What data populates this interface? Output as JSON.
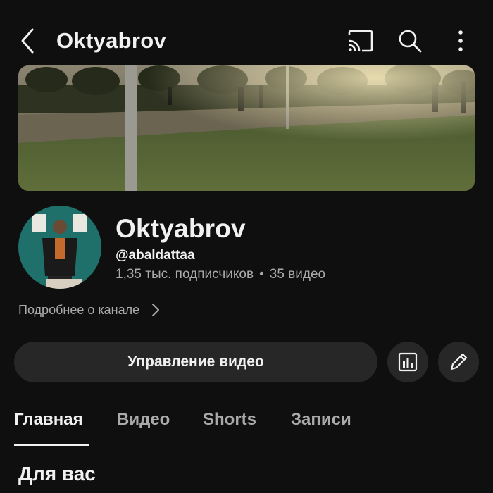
{
  "header": {
    "title": "Oktyabrov",
    "icons": [
      "back-icon",
      "cast-icon",
      "search-icon",
      "more-vert-icon"
    ]
  },
  "channel": {
    "name": "Oktyabrov",
    "handle": "@abaldattaa",
    "subscribers": "1,35 тыс. подписчиков",
    "separator": "•",
    "videos": "35 видео",
    "more_about": "Подробнее о канале"
  },
  "actions": {
    "manage_label": "Управление видео",
    "icons": [
      "analytics-icon",
      "edit-pencil-icon"
    ]
  },
  "tabs": [
    {
      "label": "Главная",
      "active": true
    },
    {
      "label": "Видео",
      "active": false
    },
    {
      "label": "Shorts",
      "active": false
    },
    {
      "label": "Записи",
      "active": false
    }
  ],
  "section": {
    "title": "Для вас"
  },
  "colors": {
    "background": "#0f0f0f",
    "text_primary": "#f1f1f1",
    "text_secondary": "#aaaaaa",
    "button_bg": "#272727"
  }
}
